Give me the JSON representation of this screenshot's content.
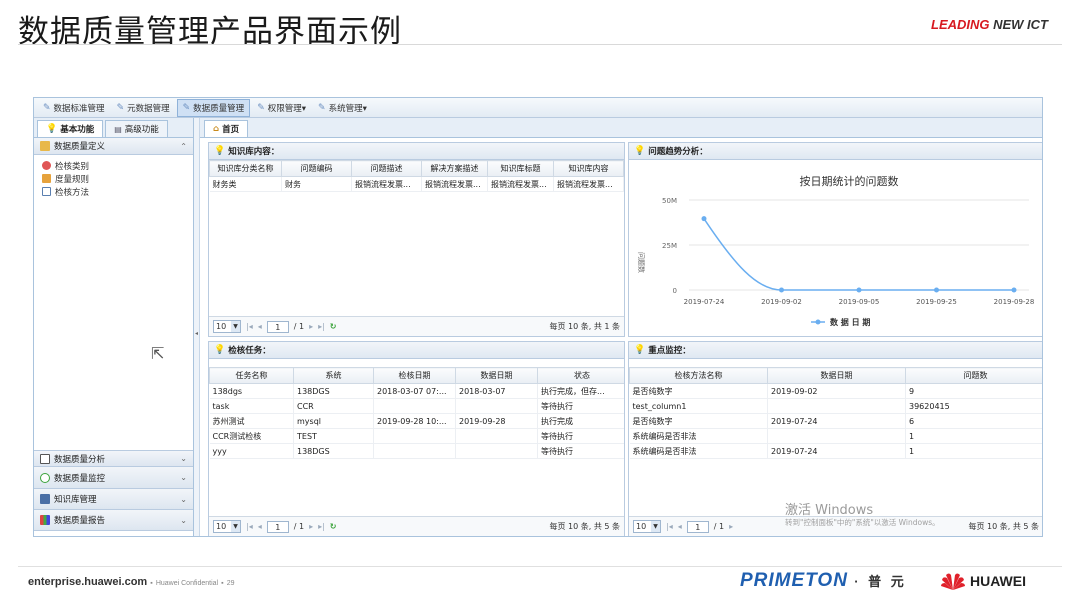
{
  "slide": {
    "title": "数据质量管理产品界面示例",
    "brand_leading": "LEADING",
    "brand_new_ict": " NEW ICT",
    "footer_site": "enterprise.huawei.com",
    "footer_confidential": "Huawei Confidential",
    "footer_page": "29",
    "primeton_logo": "PRIMETON",
    "primeton_cn": "· 普 元",
    "huawei_logo": "HUAWEI"
  },
  "menubar": {
    "items": [
      {
        "label": "数据标准管理",
        "active": false
      },
      {
        "label": "元数据管理",
        "active": false
      },
      {
        "label": "数据质量管理",
        "active": true
      },
      {
        "label": "权限管理▾",
        "active": false
      },
      {
        "label": "系统管理▾",
        "active": false
      }
    ]
  },
  "left_panel": {
    "tabs": [
      "基本功能",
      "高级功能"
    ],
    "section_title": "数据质量定义",
    "tree_items": [
      "检核类别",
      "度量规则",
      "检核方法"
    ],
    "bottom_sections": [
      "数据质量分析",
      "数据质量监控",
      "知识库管理",
      "数据质量报告"
    ]
  },
  "home_tab": "首页",
  "knowledge": {
    "title": "知识库内容：",
    "columns": [
      "知识库分类名称",
      "问题编码",
      "问题描述",
      "解决方案描述",
      "知识库标题",
      "知识库内容"
    ],
    "rows": [
      [
        "财务类",
        "财务",
        "报销流程发票...",
        "报销流程发票...",
        "报销流程发票...",
        "报销流程发票..."
      ]
    ],
    "pager": {
      "page_size": "10",
      "page": "1",
      "total_pages": "/ 1",
      "info": "每页 10 条, 共 1 条"
    }
  },
  "trend": {
    "title": "问题趋势分析：",
    "chart_data": {
      "type": "line",
      "title": "按日期统计的问题数",
      "ylabel": "问题数",
      "categories": [
        "2019-07-24",
        "2019-09-02",
        "2019-09-05",
        "2019-09-25",
        "2019-09-28"
      ],
      "series": [
        {
          "name": "数 据 日 期",
          "values": [
            39620415,
            9,
            0,
            0,
            0
          ]
        }
      ],
      "ylim": [
        0,
        50000000
      ],
      "yticks": [
        "0",
        "25M",
        "50M"
      ],
      "grid": true,
      "legend": "bottom"
    }
  },
  "tasks": {
    "title": "检核任务：",
    "columns": [
      "任务名称",
      "系统",
      "检核日期",
      "数据日期",
      "状态"
    ],
    "rows": [
      [
        "138dgs",
        "138DGS",
        "2018-03-07 07:...",
        "2018-03-07",
        "执行完成，但存..."
      ],
      [
        "task",
        "CCR",
        "",
        "",
        "等待执行"
      ],
      [
        "苏州测试",
        "mysql",
        "2019-09-28 10:...",
        "2019-09-28",
        "执行完成"
      ],
      [
        "CCR测试检核",
        "TEST",
        "",
        "",
        "等待执行"
      ],
      [
        "yyy",
        "138DGS",
        "",
        "",
        "等待执行"
      ]
    ],
    "pager": {
      "page_size": "10",
      "page": "1",
      "total_pages": "/ 1",
      "info": "每页 10 条, 共 5 条"
    }
  },
  "monitor": {
    "title": "重点监控：",
    "columns": [
      "检核方法名称",
      "数据日期",
      "问题数"
    ],
    "rows": [
      [
        "是否纯数字",
        "2019-09-02",
        "9"
      ],
      [
        "test_column1",
        "",
        "39620415"
      ],
      [
        "是否纯数字",
        "2019-07-24",
        "6"
      ],
      [
        "系统编码是否非法",
        "",
        "1"
      ],
      [
        "系统编码是否非法",
        "2019-07-24",
        "1"
      ]
    ],
    "pager": {
      "page_size": "10",
      "page": "1",
      "total_pages": "/ 1",
      "info": "每页 10 条, 共 5 条"
    }
  },
  "watermark": {
    "line1": "激活 Windows",
    "line2": "转到\"控制面板\"中的\"系统\"以激活 Windows。"
  }
}
